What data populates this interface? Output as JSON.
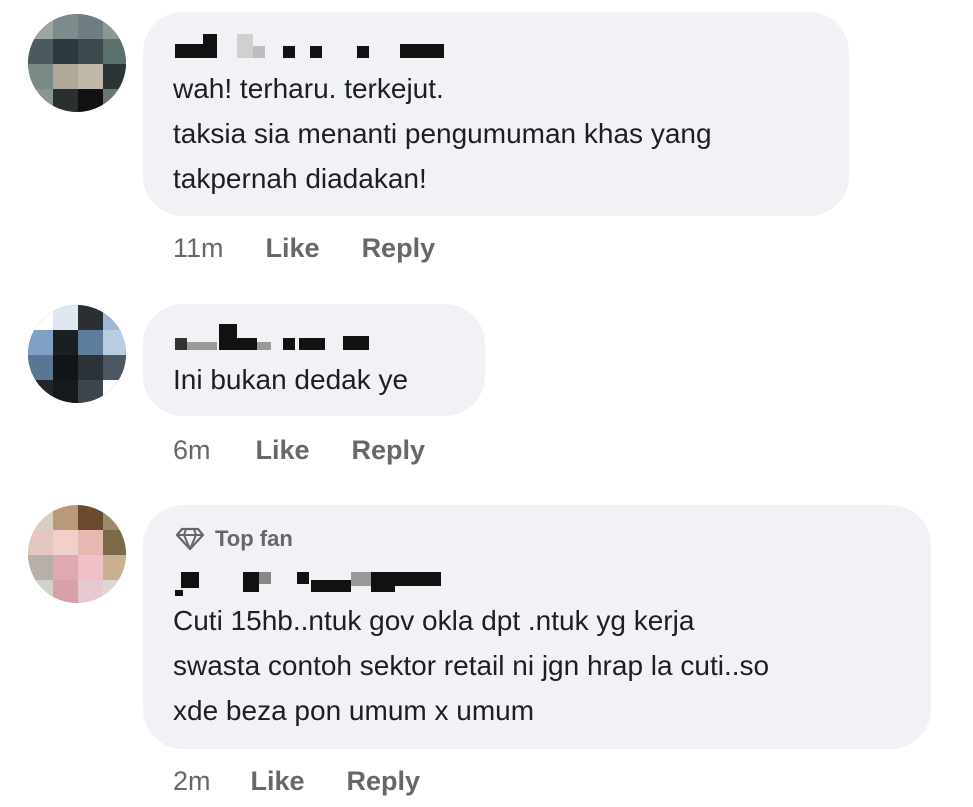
{
  "comments": [
    {
      "author_redacted": true,
      "lines": [
        "wah! terharu. terkejut.",
        "taksia sia menanti pengumuman khas yang",
        "takpernah diadakan!"
      ],
      "time": "11m",
      "like_label": "Like",
      "reply_label": "Reply"
    },
    {
      "author_redacted": true,
      "lines": [
        "Ini bukan dedak ye"
      ],
      "time": "6m",
      "like_label": "Like",
      "reply_label": "Reply"
    },
    {
      "author_redacted": true,
      "badge": {
        "icon": "diamond-icon",
        "label": "Top fan"
      },
      "lines": [
        "Cuti 15hb..ntuk gov okla dpt .ntuk yg kerja",
        "swasta contoh sektor retail ni jgn hrap la cuti..so",
        "xde beza pon umum x umum"
      ],
      "time": "2m",
      "like_label": "Like",
      "reply_label": "Reply"
    }
  ],
  "colors": {
    "bubble": "#f0f2f5",
    "text": "#1c1e21",
    "meta": "#65676b"
  }
}
